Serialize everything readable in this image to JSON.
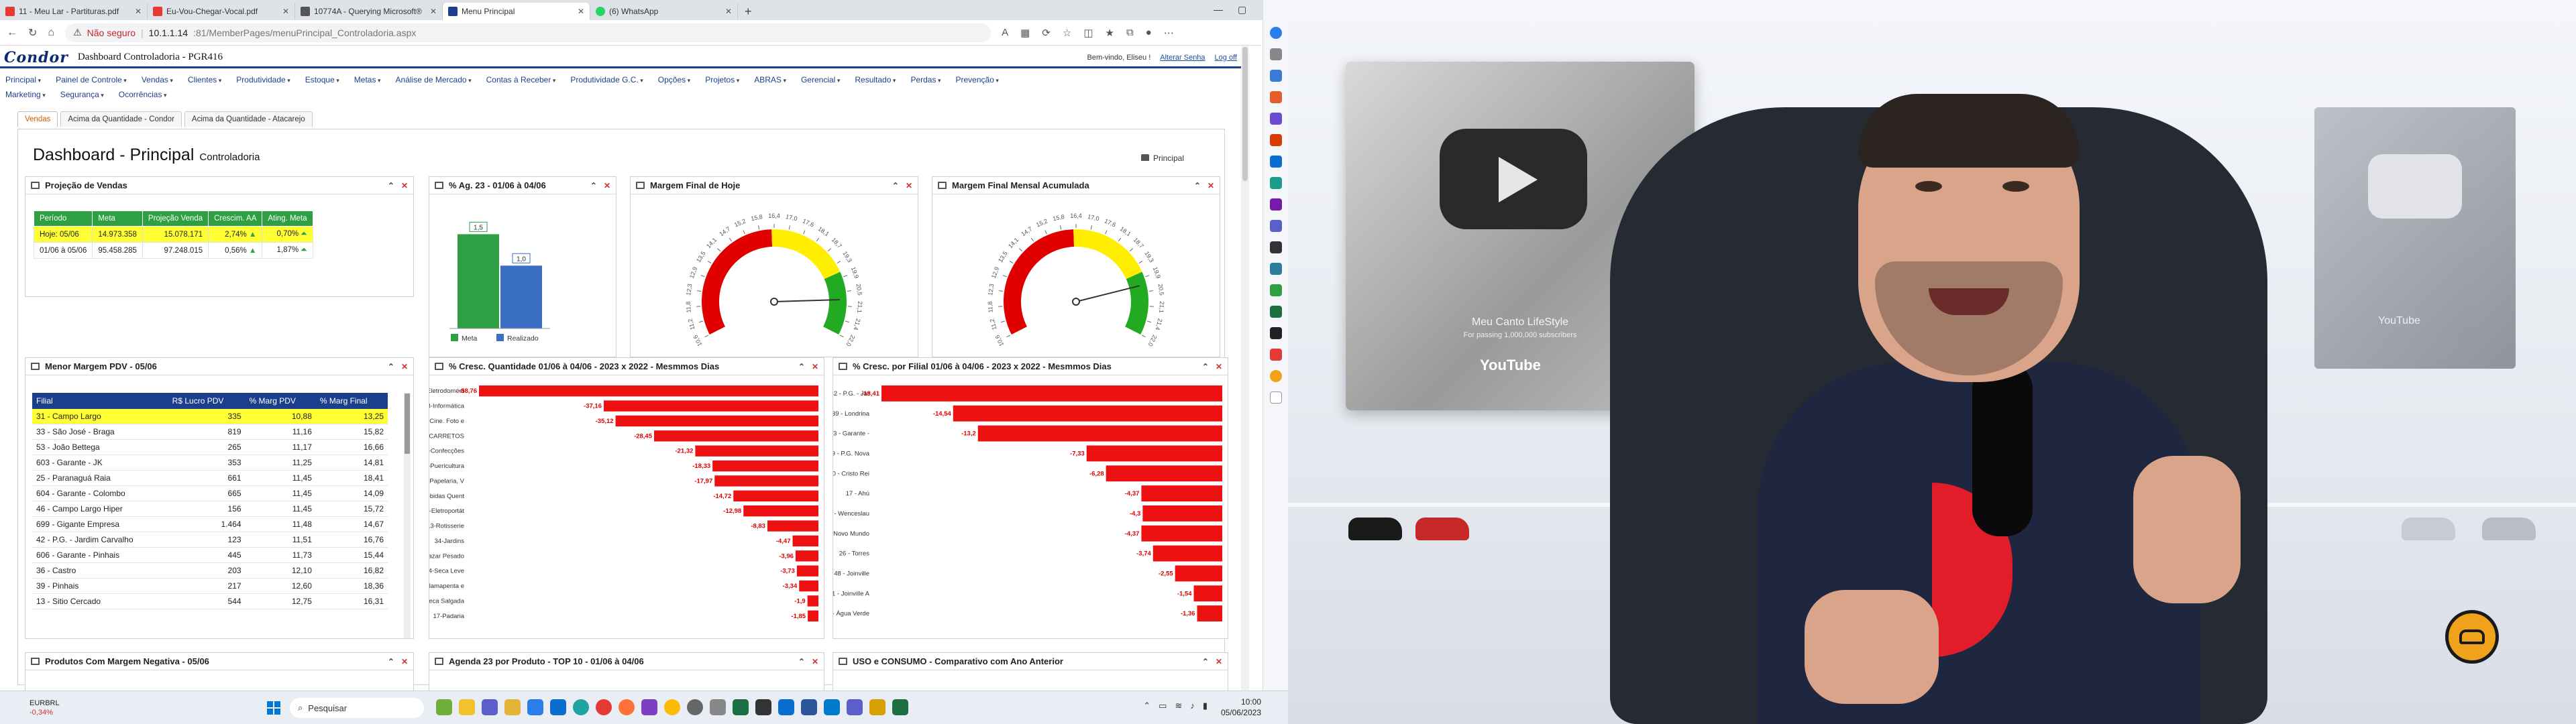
{
  "browser": {
    "tabs": [
      {
        "label": "11 - Meu Lar - Partituras.pdf",
        "color": "#e53935"
      },
      {
        "label": "Eu-Vou-Chegar-Vocal.pdf",
        "color": "#e53935"
      },
      {
        "label": "10774A - Querying Microsoft®",
        "color": "#555555"
      },
      {
        "label": "Menu Principal",
        "color": "#1b3f8c",
        "active": true
      },
      {
        "label": "(6) WhatsApp",
        "color": "#25d366"
      }
    ],
    "new_tab": "+",
    "url_security": "Não seguro",
    "url_host": "10.1.1.14",
    "url_path": ":81/MemberPages/menuPrincipal_Controladoria.aspx"
  },
  "app": {
    "logo": "Condor",
    "title": "Dashboard Controladoria - PGR416",
    "greeting": "Bem-vindo, Eliseu !",
    "change_password": "Alterar Senha",
    "logout": "Log off",
    "menu_row1": [
      "Principal",
      "Painel de Controle",
      "Vendas",
      "Clientes",
      "Produtividade",
      "Estoque",
      "Metas",
      "Análise de Mercado",
      "Contas à Receber",
      "Produtividade G.C.",
      "Opções",
      "Projetos",
      "ABRAS",
      "Gerencial",
      "Resultado",
      "Perdas",
      "Prevenção"
    ],
    "menu_row2": [
      "Marketing",
      "Segurança",
      "Ocorrências"
    ],
    "subtabs": [
      "Vendas",
      "Acima da Quantidade - Condor",
      "Acima da Quantidade - Atacarejo"
    ],
    "page_title": "Dashboard - Principal",
    "page_subtitle": "Controladoria",
    "breadcrumb": "Principal",
    "breadcrumb2": "Dashboard"
  },
  "widgets": {
    "projecao": {
      "title": "Projeção de Vendas",
      "headers": [
        "Período",
        "Meta",
        "Projeção Venda",
        "Crescim. AA",
        "Ating. Meta"
      ],
      "rows": [
        [
          "Hoje: 05/06",
          "14.973.358",
          "15.078.171",
          "2,74%",
          "0,70%"
        ],
        [
          "01/06 à 05/06",
          "95.458.285",
          "97.248.015",
          "0,56%",
          "1,87%"
        ]
      ]
    },
    "ag23": {
      "title": "% Ag. 23 - 01/06 à 04/06",
      "legend_meta": "Meta",
      "legend_realizado": "Realizado",
      "label_meta": "1,5",
      "label_realizado": "1,0"
    },
    "margem_hoje": {
      "title": "Margem Final de Hoje"
    },
    "margem_mensal": {
      "title": "Margem Final Mensal Acumulada"
    },
    "menor_margem": {
      "title": "Menor Margem PDV - 05/06",
      "headers": [
        "Filial",
        "R$ Lucro PDV",
        "% Marg PDV",
        "% Marg Final"
      ],
      "rows": [
        [
          "31 - Campo Largo",
          "335",
          "10,88",
          "13,25"
        ],
        [
          "33 - São José - Braga",
          "819",
          "11,16",
          "15,82"
        ],
        [
          "53 - João Bettega",
          "265",
          "11,17",
          "16,66"
        ],
        [
          "603 - Garante - JK",
          "353",
          "11,25",
          "14,81"
        ],
        [
          "25 - Paranaguá Raia",
          "661",
          "11,45",
          "18,41"
        ],
        [
          "604 - Garante - Colombo",
          "665",
          "11,45",
          "14,09"
        ],
        [
          "46 - Campo Largo Hiper",
          "156",
          "11,45",
          "15,72"
        ],
        [
          "699 - Gigante Empresa",
          "1.464",
          "11,48",
          "14,67"
        ],
        [
          "42 - P.G. - Jardim Carvalho",
          "123",
          "11,51",
          "16,76"
        ],
        [
          "606 - Garante - Pinhais",
          "445",
          "11,73",
          "15,44"
        ],
        [
          "36 - Castro",
          "203",
          "12,10",
          "16,82"
        ],
        [
          "39 - Pinhais",
          "217",
          "12,60",
          "18,36"
        ],
        [
          "13 - Sitio Cercado",
          "544",
          "12,75",
          "16,31"
        ]
      ]
    },
    "cresc_qtd": {
      "title": "% Cresc. Quantidade 01/06 à 04/06 - 2023 x 2022 - Mesmmos Dias"
    },
    "cresc_filial": {
      "title": "% Cresc. por Filial 01/06 à 04/06 - 2023 x 2022 - Mesmmos Dias"
    },
    "negativa": {
      "title": "Produtos Com Margem Negativa - 05/06"
    },
    "agenda": {
      "title": "Agenda 23 por Produto - TOP 10 - 01/06 à 04/06"
    },
    "uso_consumo": {
      "title": "USO e CONSUMO - Comparativo com Ano Anterior"
    }
  },
  "chart_data": [
    {
      "type": "bar",
      "title": "% Ag. 23 - 01/06 à 04/06",
      "categories": [
        "Meta",
        "Realizado"
      ],
      "values": [
        1.5,
        1.0
      ],
      "colors": [
        "#2ea043",
        "#3a6fc4"
      ]
    },
    {
      "type": "bar",
      "orientation": "horizontal",
      "title": "% Cresc. Quantidade 01/06 à 04/06 - 2023 x 2022 - Mesmmos Dias",
      "categories": [
        "90-Eletrodomést",
        "93-Informática",
        "94-Cine. Foto e",
        "98-CARRETOS",
        "41-Confecções",
        "49-Puericultura",
        "51-Papelaria, V",
        "07-Bebidas Quent",
        "91-Eletroportát",
        "13-Rotisserie",
        "34-Jardins",
        "01-Bazar Pesado",
        "04-Seca Leve",
        "30-Flamapenta e",
        "02-Seca Salgada",
        "17-Padaria"
      ],
      "values": [
        -58.76,
        -37.16,
        -35.12,
        -28.45,
        -21.32,
        -18.33,
        -17.97,
        -14.72,
        -12.98,
        -8.83,
        -4.47,
        -3.96,
        -3.73,
        -3.34,
        -1.9,
        -1.85
      ],
      "value_labels": [
        "-58,76",
        "-37,16",
        "-35,12",
        "-28,45",
        "-21,32",
        "-18,33",
        "-17,97",
        "-14,72",
        "-12,98",
        "-8,83",
        "-4,47",
        "-3,96",
        "-3,73",
        "-3,34",
        "-1,9",
        "-1,85"
      ],
      "color": "#ee1111"
    },
    {
      "type": "bar",
      "orientation": "horizontal",
      "title": "% Cresc. por Filial 01/06 à 04/06 - 2023 x 2022 - Mesmmos Dias",
      "categories": [
        "42 - P.G. - Jar",
        "39 - Londrina",
        "603 - Garante -",
        "19 - P.G. Nova",
        "20 - Cristo Rei",
        "17 - Ahú",
        "37 - Wenceslau",
        "27 - Novo Mundo",
        "26 - Torres",
        "48 - Joinville",
        "51 - Joinville A",
        "29 - Água Verde"
      ],
      "values": [
        -18.41,
        -14.54,
        -13.2,
        -7.33,
        -6.28,
        -4.37,
        -4.3,
        -4.37,
        -3.74,
        -2.55,
        -1.54,
        -1.36
      ],
      "value_labels": [
        "-18,41",
        "-14,54",
        "-13,2",
        "-7,33",
        "-6,28",
        "-4,37",
        "-4,3",
        "-4,37",
        "-3,74",
        "-2,55",
        "-1,54",
        "-1,36"
      ],
      "color": "#ee1111"
    },
    {
      "type": "gauge",
      "title": "Margem Final de Hoje",
      "min": 10.6,
      "max": 22.0,
      "value": 20.6,
      "ticks": [
        "10,6",
        "11,2",
        "11,8",
        "12,3",
        "12,9",
        "13,5",
        "14,1",
        "14,7",
        "15,2",
        "15,8",
        "16,4",
        "17,0",
        "17,6",
        "18,1",
        "18,7",
        "19,3",
        "19,9",
        "20,5",
        "21,1",
        "21,4",
        "22,0"
      ],
      "bands": [
        {
          "to": 16.2,
          "color": "#e00000"
        },
        {
          "to": 19.5,
          "color": "#ffee00"
        },
        {
          "to": 22.0,
          "color": "#22aa22"
        }
      ]
    },
    {
      "type": "gauge",
      "title": "Margem Final Mensal Acumulada",
      "min": 10.6,
      "max": 22.0,
      "value": 20.0,
      "ticks": [
        "10,6",
        "11,2",
        "11,8",
        "12,3",
        "12,9",
        "13,5",
        "14,1",
        "14,7",
        "15,2",
        "15,8",
        "16,4",
        "17,0",
        "17,6",
        "18,1",
        "18,7",
        "19,3",
        "19,9",
        "20,5",
        "21,1",
        "21,4",
        "22,0"
      ],
      "bands": [
        {
          "to": 16.2,
          "color": "#e00000"
        },
        {
          "to": 19.5,
          "color": "#ffee00"
        },
        {
          "to": 22.0,
          "color": "#22aa22"
        }
      ]
    }
  ],
  "taskbar": {
    "ticker_name": "EURBRL",
    "ticker_value": "-0,34%",
    "search_placeholder": "Pesquisar",
    "time": "10:00",
    "date": "05/06/2023"
  },
  "video": {
    "plaque_name": "Meu Canto LifeStyle",
    "plaque_caption": "For passing 1,000,000 subscribers",
    "plaque_brand": "YouTube",
    "plaque2_brand": "YouTube"
  }
}
